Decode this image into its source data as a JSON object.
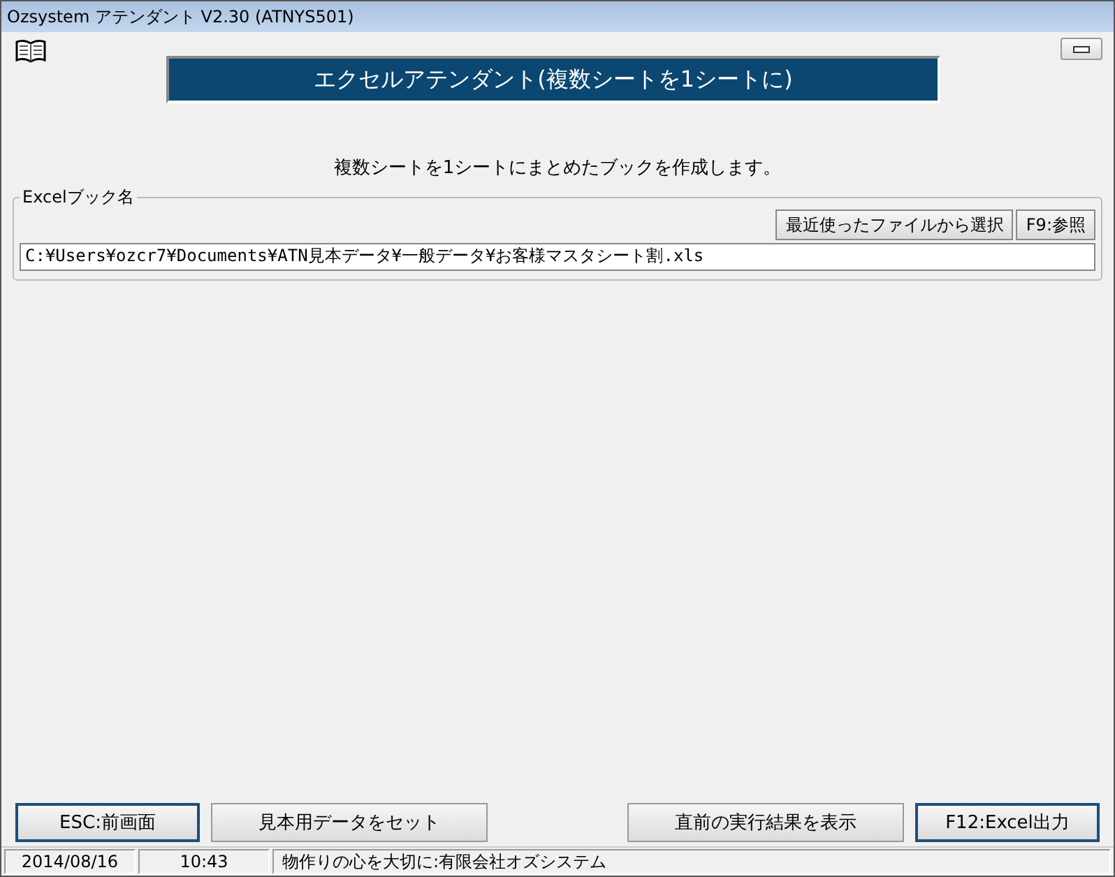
{
  "window": {
    "title": "Ozsystem アテンダント V2.30 (ATNYS501)"
  },
  "header": {
    "title": "エクセルアテンダント(複数シートを1シートに)"
  },
  "description": "複数シートを1シートにまとめたブックを作成します。",
  "excel_book": {
    "label": "Excelブック名",
    "buttons": [
      "最近使ったファイルから選択",
      "F9:参照"
    ],
    "path": "C:¥Users¥ozcr7¥Documents¥ATN見本データ¥一般データ¥お客様マスタシート割.xls"
  },
  "left_buttons": [
    {
      "label": "ESC:前画面",
      "emphasized": true
    },
    {
      "label": "見本用データをセット",
      "emphasized": false
    }
  ],
  "right_buttons": [
    {
      "label": "直前の実行結果を表示",
      "emphasized": false
    },
    {
      "label": "F12:Excel出力",
      "emphasized": true
    }
  ],
  "status_bar": [
    "2014/08/16",
    "10:43",
    "物作りの心を大切に:有限会社オズシステム"
  ]
}
